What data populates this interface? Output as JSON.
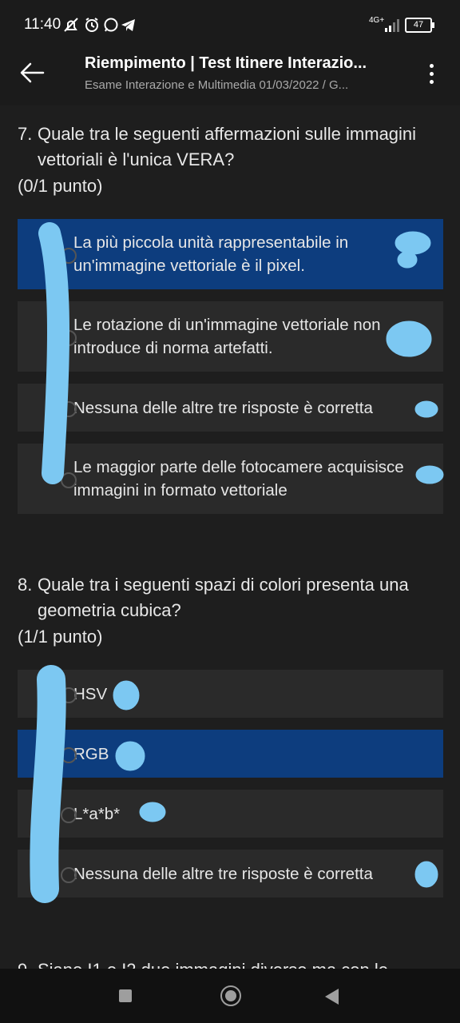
{
  "status_bar": {
    "time": "11:40",
    "icons": [
      "mute-icon",
      "alarm-icon",
      "whatsapp-icon",
      "telegram-icon"
    ],
    "network": "4G+",
    "battery": "47"
  },
  "header": {
    "title": "Riempimento | Test Itinere Interazio...",
    "subtitle": "Esame Interazione e Multimedia 01/03/2022 / G..."
  },
  "questions": [
    {
      "number": "7.",
      "text": "Quale tra le seguenti affermazioni sulle immagini vettoriali è l'unica VERA?",
      "points": "(0/1 punto)",
      "options": [
        {
          "label": "La più piccola unità rappresentabile in un'immagine vettoriale è il pixel.",
          "selected": true
        },
        {
          "label": "Le rotazione di un'immagine vettoriale non introduce di norma artefatti.",
          "selected": false
        },
        {
          "label": "Nessuna delle altre tre risposte è corretta",
          "selected": false
        },
        {
          "label": "Le maggior parte delle fotocamere acquisisce immagini in formato vettoriale",
          "selected": false
        }
      ]
    },
    {
      "number": "8.",
      "text": "Quale tra i seguenti spazi di colori presenta una geometria cubica?",
      "points": "(1/1 punto)",
      "options": [
        {
          "label": "HSV",
          "selected": false
        },
        {
          "label": "RGB",
          "selected": true
        },
        {
          "label": "L*a*b*",
          "selected": false
        },
        {
          "label": "Nessuna delle altre tre risposte è corretta",
          "selected": false
        }
      ]
    },
    {
      "number": "9.",
      "text": "Siano I1 e I2 due immagini diverse ma con le"
    }
  ],
  "colors": {
    "selected": "#0d3d7e",
    "option_bg": "#2a2a2a",
    "background": "#1e1e1e",
    "scribble": "#7cc8f2"
  }
}
